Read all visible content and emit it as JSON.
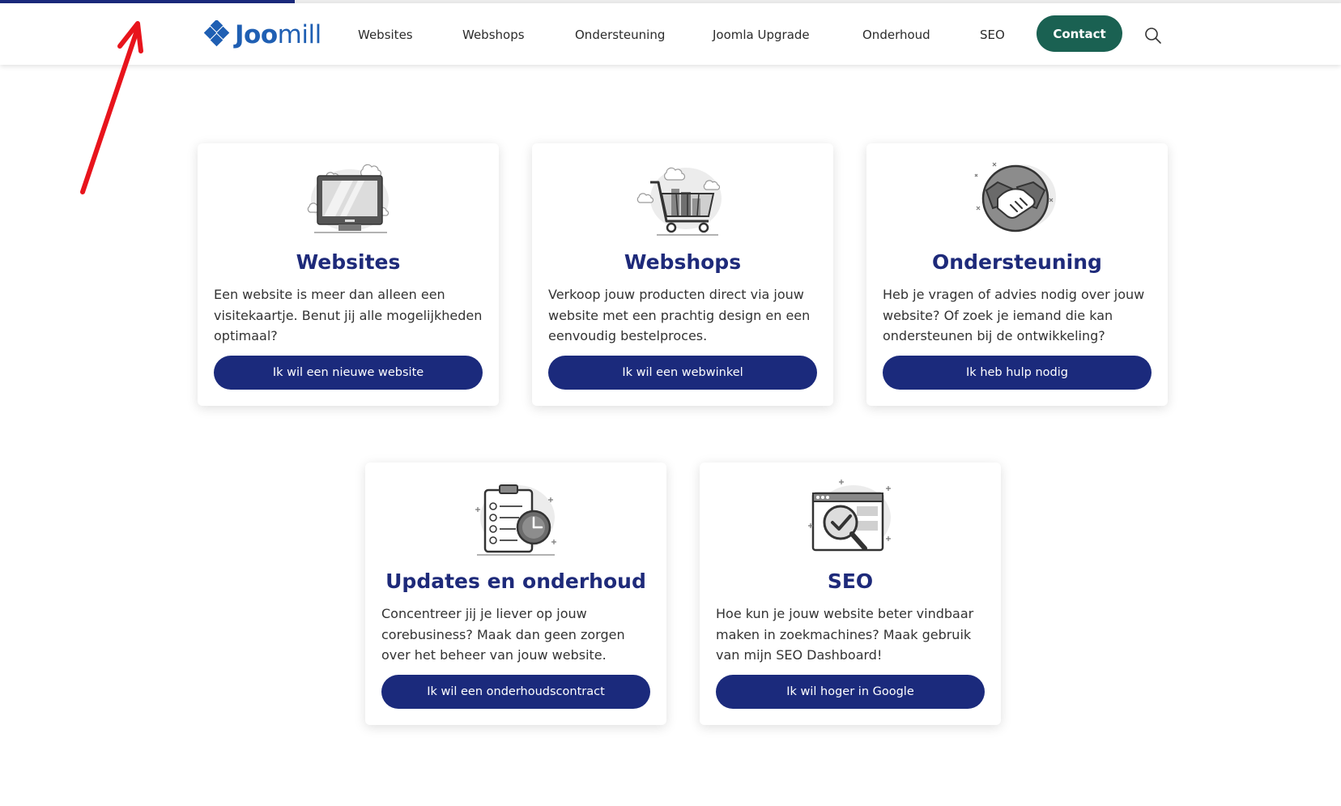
{
  "page": {
    "scroll_progress_percent": 22
  },
  "header": {
    "logo": {
      "part1": "Joo",
      "part2": "mill"
    },
    "nav": [
      "Websites",
      "Webshops",
      "Ondersteuning",
      "Joomla Upgrade",
      "Onderhoud",
      "SEO"
    ],
    "contact_label": "Contact",
    "search_icon": "search-icon"
  },
  "cards": [
    {
      "title": "Websites",
      "description": "Een website is meer dan alleen een visitekaartje. Benut jij alle mogelijkheden optimaal?",
      "button": "Ik wil een nieuwe website",
      "icon": "monitor-icon"
    },
    {
      "title": "Webshops",
      "description": "Verkoop jouw producten direct via jouw website met een prachtig design en een eenvoudig bestelproces.",
      "button": "Ik wil een webwinkel",
      "icon": "shopping-cart-icon"
    },
    {
      "title": "Ondersteuning",
      "description": "Heb je vragen of advies nodig over jouw website? Of zoek je iemand die kan ondersteunen bij de ontwikkeling?",
      "button": "Ik heb hulp nodig",
      "icon": "handshake-icon"
    },
    {
      "title": "Updates en onderhoud",
      "description": "Concentreer jij je liever op jouw corebusiness? Maak dan geen zorgen over het beheer van jouw website.",
      "button": "Ik wil een onderhoudscontract",
      "icon": "clipboard-clock-icon"
    },
    {
      "title": "SEO",
      "description": "Hoe kun je jouw website beter vindbaar maken in zoekmachines? Maak gebruik van mijn SEO Dashboard!",
      "button": "Ik wil hoger in Google",
      "icon": "magnifier-check-icon"
    }
  ],
  "colors": {
    "brand_navy": "#1b2a7c",
    "title_navy": "#1e2a7a",
    "contact_green": "#1a6152",
    "logo_blue": "#1f5fb3",
    "annotation_red": "#e8141c"
  }
}
